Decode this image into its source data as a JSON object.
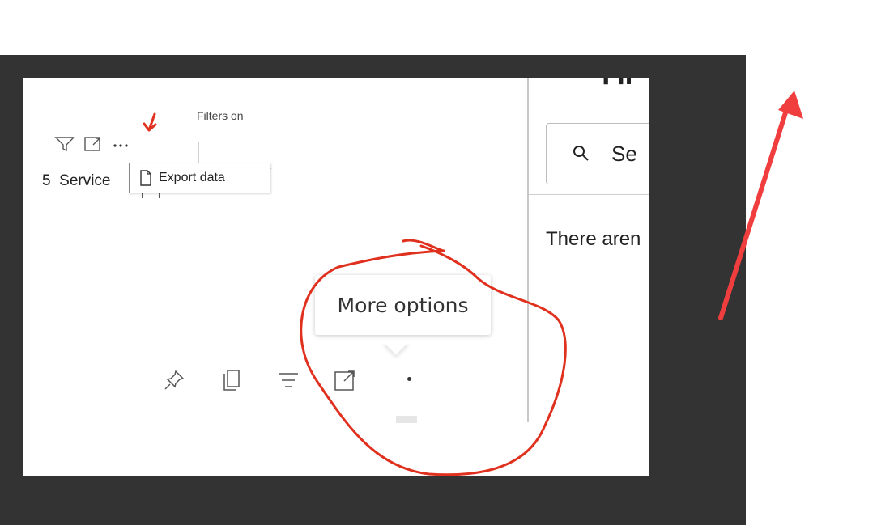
{
  "visual_header": {
    "filters_label": "Filters on",
    "row_number": "5",
    "row_label": "Service",
    "context_menu": {
      "export_data_label": "Export data"
    }
  },
  "filter_pane": {
    "title_partial": "Fil",
    "search_placeholder_partial": "Se",
    "empty_message_partial": "There aren"
  },
  "tooltip": {
    "text": "More options"
  },
  "annotations": {
    "colors": {
      "red_ink": "#e0301e",
      "red_arrow": "#f03e3e"
    }
  }
}
